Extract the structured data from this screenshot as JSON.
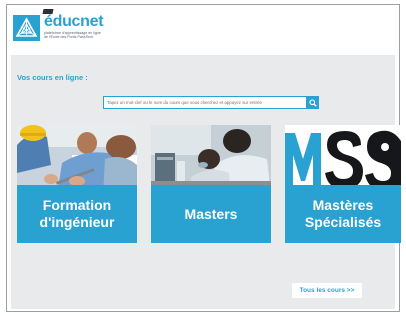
{
  "header": {
    "brand_rest": "ducnet",
    "brand_e": "é",
    "tagline_line1": "plateforme d'apprentissage en ligne",
    "tagline_line2": "de l'École des Ponts ParisTech"
  },
  "courses": {
    "section_title": "Vos cours en ligne :",
    "search_placeholder": "Tapez un mot-clef ou le nom du cours que vous cherchez et appuyez sur entrée",
    "cards": [
      {
        "label": "Formation\nd'ingénieur"
      },
      {
        "label": "Masters"
      },
      {
        "label": "Mastères\nSpécialisés"
      }
    ],
    "all_courses_label": "Tous les cours >>"
  },
  "colors": {
    "accent": "#2aa2d1",
    "background": "#e9eaec"
  }
}
